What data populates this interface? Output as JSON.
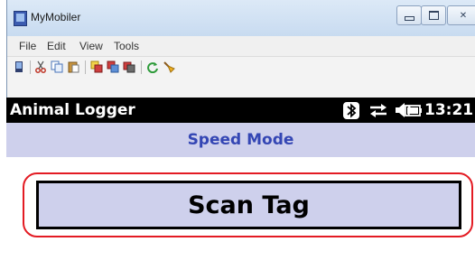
{
  "window": {
    "title": "MyMobiler",
    "controls": {
      "minimize": "minimize",
      "maximize": "maximize",
      "close": "✕"
    }
  },
  "menu": [
    "File",
    "Edit",
    "View",
    "Tools"
  ],
  "toolbar": {
    "icons": [
      "device-icon",
      "cut-icon",
      "copy-icon",
      "paste-icon",
      "copy-to-device-icon",
      "copy-from-device-icon",
      "screenshot-icon",
      "refresh-icon",
      "clean-icon"
    ]
  },
  "device": {
    "status_bar": {
      "app_name": "Animal Logger",
      "icons": [
        "bluetooth-icon",
        "sync-icon",
        "volume-icon",
        "battery-icon"
      ],
      "time": "13:21"
    },
    "mode_title": "Speed Mode",
    "scan_button_label": "Scan Tag",
    "colors": {
      "accent": "#3446b4",
      "band": "#ced0ec",
      "highlight": "#e31b23"
    }
  }
}
